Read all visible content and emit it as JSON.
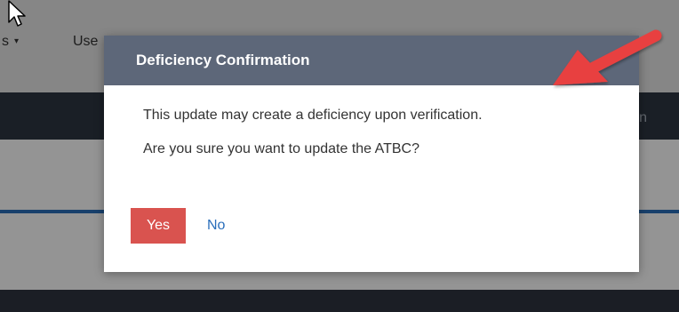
{
  "background": {
    "nav_items": [
      "s",
      "Use"
    ]
  },
  "dialog": {
    "title": "Deficiency Confirmation",
    "messages": [
      "This update may create a deficiency upon verification.",
      "Are you sure you want to update the ATBC?"
    ],
    "yes_label": "Yes",
    "no_label": "No"
  },
  "colors": {
    "header": "#5d6779",
    "yes_button": "#d9534f",
    "link": "#2a6ebb",
    "annotation_arrow": "#e8403f"
  },
  "icons": {
    "cursor": "mouse-pointer-icon",
    "annotation": "red-arrow-icon"
  }
}
